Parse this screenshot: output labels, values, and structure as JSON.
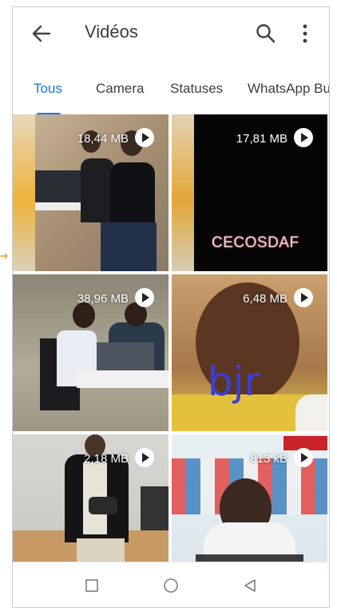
{
  "header": {
    "title": "Vidéos"
  },
  "tabs": [
    {
      "label": "Tous"
    },
    {
      "label": "Camera"
    },
    {
      "label": "Statuses"
    },
    {
      "label": "WhatsApp Bu"
    }
  ],
  "videos": [
    {
      "size": "18,44 MB"
    },
    {
      "size": "17,81 MB",
      "overlay": "CECOSDAF"
    },
    {
      "size": "38,96 MB"
    },
    {
      "size": "6,48 MB",
      "overlay": "bjr"
    },
    {
      "size": "2,18 MB"
    },
    {
      "size": "813 kB"
    }
  ],
  "colors": {
    "accent": "#1a73e8",
    "marker": "#f29b38"
  }
}
